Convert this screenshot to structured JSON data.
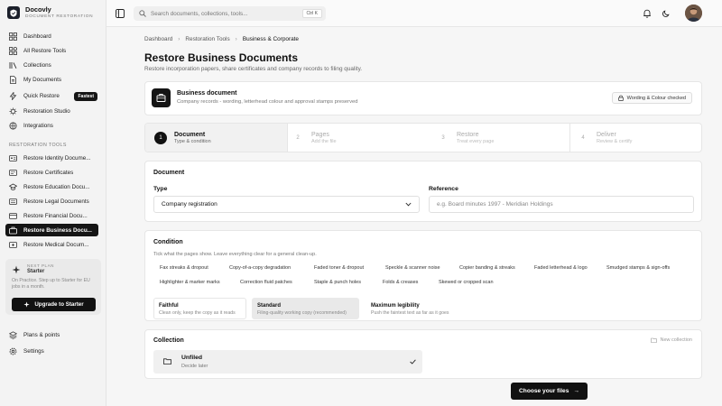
{
  "brand": {
    "name": "Docovly",
    "tagline": "DOCUMENT RESTORATION"
  },
  "sidebar": {
    "top_items": [
      {
        "label": "Dashboard",
        "icon": "dashboard-icon"
      },
      {
        "label": "All Restore Tools",
        "icon": "tools-icon"
      },
      {
        "label": "Collections",
        "icon": "collections-icon"
      },
      {
        "label": "My Documents",
        "icon": "document-icon"
      },
      {
        "label": "Quick Restore",
        "icon": "lightning-icon",
        "badge": "Fastest"
      },
      {
        "label": "Restoration Studio",
        "icon": "studio-icon"
      },
      {
        "label": "Integrations",
        "icon": "integrations-icon"
      }
    ],
    "section_label": "RESTORATION TOOLS",
    "tools": [
      {
        "label": "Restore Identity Docume...",
        "active": false
      },
      {
        "label": "Restore Certificates",
        "active": false
      },
      {
        "label": "Restore Education Docu...",
        "active": false
      },
      {
        "label": "Restore Legal Documents",
        "active": false
      },
      {
        "label": "Restore Financial Docu...",
        "active": false
      },
      {
        "label": "Restore Business Docu...",
        "active": true
      },
      {
        "label": "Restore Medical Docum...",
        "active": false
      }
    ],
    "plan": {
      "kicker": "NEXT PLAN",
      "name": "Starter",
      "description": "On Practice. Step up to Starter for EU jobs in a month.",
      "button": "Upgrade to Starter"
    },
    "bottom_items": [
      {
        "label": "Plans & points"
      },
      {
        "label": "Settings"
      }
    ]
  },
  "topbar": {
    "search_placeholder": "Search documents, collections, tools...",
    "shortcut": "Ctrl K"
  },
  "breadcrumb": [
    "Dashboard",
    "Restoration Tools",
    "Business & Corporate"
  ],
  "page": {
    "title": "Restore Business Documents",
    "subtitle": "Restore incorporation papers, share certificates and company records to filing quality."
  },
  "doc_card": {
    "title": "Business document",
    "subtitle": "Company records - wording, letterhead colour and approval stamps preserved",
    "pill": "Wording & Colour checked"
  },
  "steps": [
    {
      "num": "1",
      "title": "Document",
      "sub": "Type & condition",
      "active": true
    },
    {
      "num": "2",
      "title": "Pages",
      "sub": "Add the file",
      "active": false
    },
    {
      "num": "3",
      "title": "Restore",
      "sub": "Treat every page",
      "active": false
    },
    {
      "num": "4",
      "title": "Deliver",
      "sub": "Review & certify",
      "active": false
    }
  ],
  "document_section": {
    "heading": "Document",
    "type_label": "Type",
    "type_value": "Company registration",
    "reference_label": "Reference",
    "reference_placeholder": "e.g. Board minutes 1997 - Meridian Holdings"
  },
  "condition": {
    "heading": "Condition",
    "subtitle": "Tick what the pages show. Leave everything clear for a general clean-up.",
    "chips_row1": [
      "Fax streaks & dropout",
      "Copy-of-a-copy degradation",
      "Faded toner & dropout",
      "Speckle & scanner noise",
      "Copier banding & streaks",
      "Faded letterhead & logo",
      "Smudged stamps & sign-offs"
    ],
    "chips_row2": [
      "Highlighter & marker marks",
      "Correction fluid patches",
      "Staple & punch holes",
      "Folds & creases",
      "Skewed or cropped scan"
    ],
    "levels": [
      {
        "title": "Faithful",
        "sub": "Clean only, keep the copy as it reads",
        "selected": false
      },
      {
        "title": "Standard",
        "sub": "Filing-quality working copy (recommended)",
        "selected": true
      },
      {
        "title": "Maximum legibility",
        "sub": "Push the faintest text as far as it goes",
        "selected": false
      }
    ]
  },
  "collection": {
    "heading": "Collection",
    "new_label": "New collection",
    "folder_title": "Unfiled",
    "folder_sub": "Decide later"
  },
  "cta": {
    "label": "Choose your files",
    "arrow": "→"
  }
}
